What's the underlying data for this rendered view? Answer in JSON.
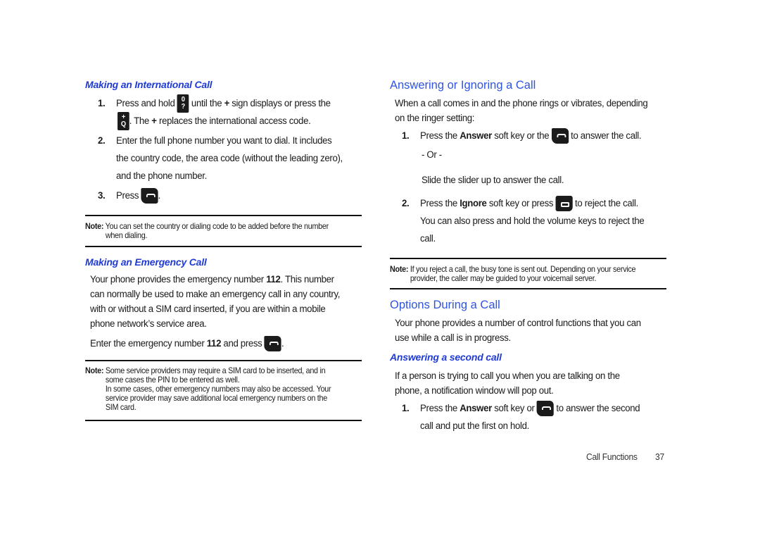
{
  "left": {
    "intl": {
      "heading": "Making an International Call",
      "steps": [
        {
          "num": "1.",
          "a": "Press and hold",
          "b": "until the",
          "plus": "+",
          "c": "sign displays or press the",
          "d": ". The",
          "plus2": "+",
          "e": "replaces the international access code."
        },
        {
          "num": "2.",
          "line1": "Enter the full phone number you want to dial. It includes",
          "line2": "the country code, the area code (without the leading zero),",
          "line3": "and the phone number."
        },
        {
          "num": "3.",
          "a": "Press",
          "b": "."
        }
      ],
      "key_zero": {
        "top": "0",
        "bottom": "?"
      },
      "key_q": {
        "top": "+",
        "bottom": "Q"
      }
    },
    "note1": {
      "label": "Note:",
      "line1": "You can set the country or dialing code to be added before the number",
      "line2": "when dialing."
    },
    "emergency": {
      "heading": "Making an Emergency Call",
      "para_l1a": "Your phone provides the emergency number",
      "para_num": "112",
      "para_l1b": ". This number",
      "para_l2": "can normally be used to make an emergency call in any country,",
      "para_l3": "with or without a SIM card inserted, if you are within a mobile",
      "para_l4": "phone network’s service area.",
      "enter_a": "Enter the emergency number",
      "enter_num": "112",
      "enter_b": "and press",
      "enter_c": "."
    },
    "note2": {
      "label": "Note:",
      "line1": "Some service providers may require a SIM card to be inserted, and in",
      "line2": "some cases the PIN to be entered as well.",
      "line3": "In some cases, other emergency numbers may also be accessed. Your",
      "line4": "service provider may save additional local emergency numbers on the",
      "line5": "SIM card."
    }
  },
  "right": {
    "answering": {
      "heading": "Answering or Ignoring a Call",
      "intro1": "When a call comes in and the phone rings or vibrates, depending",
      "intro2": "on the ringer setting:",
      "step1_num": "1.",
      "step1_a": "Press the",
      "step1_bold": "Answer",
      "step1_b": "soft key or the",
      "step1_c": "to answer the call.",
      "or": "- Or -",
      "slide": "Slide the slider up to answer the call.",
      "step2_num": "2.",
      "step2_a": "Press the",
      "step2_bold": "Ignore",
      "step2_b": "soft key or press",
      "step2_c": "to reject the call.",
      "step2_l2": "You can also press and hold the volume keys to reject the",
      "step2_l3": "call."
    },
    "note3": {
      "label": "Note:",
      "line1": "If you reject a call, the busy tone is sent out. Depending on your service",
      "line2": "provider, the caller may be guided to your voicemail server."
    },
    "options": {
      "heading": "Options During a Call",
      "para1": "Your phone provides a number of control functions that you can",
      "para2": "use while a call is in progress."
    },
    "second": {
      "heading": "Answering a second call",
      "para1": "If a person is trying to call you when you are talking on the",
      "para2": "phone, a notification window will pop out.",
      "step_num": "1.",
      "step_a": "Press the",
      "step_bold": "Answer",
      "step_b": "soft key or",
      "step_c": "to answer the second",
      "step_l2": "call and put the first on hold."
    }
  },
  "footer": {
    "section": "Call Functions",
    "page": "37"
  }
}
